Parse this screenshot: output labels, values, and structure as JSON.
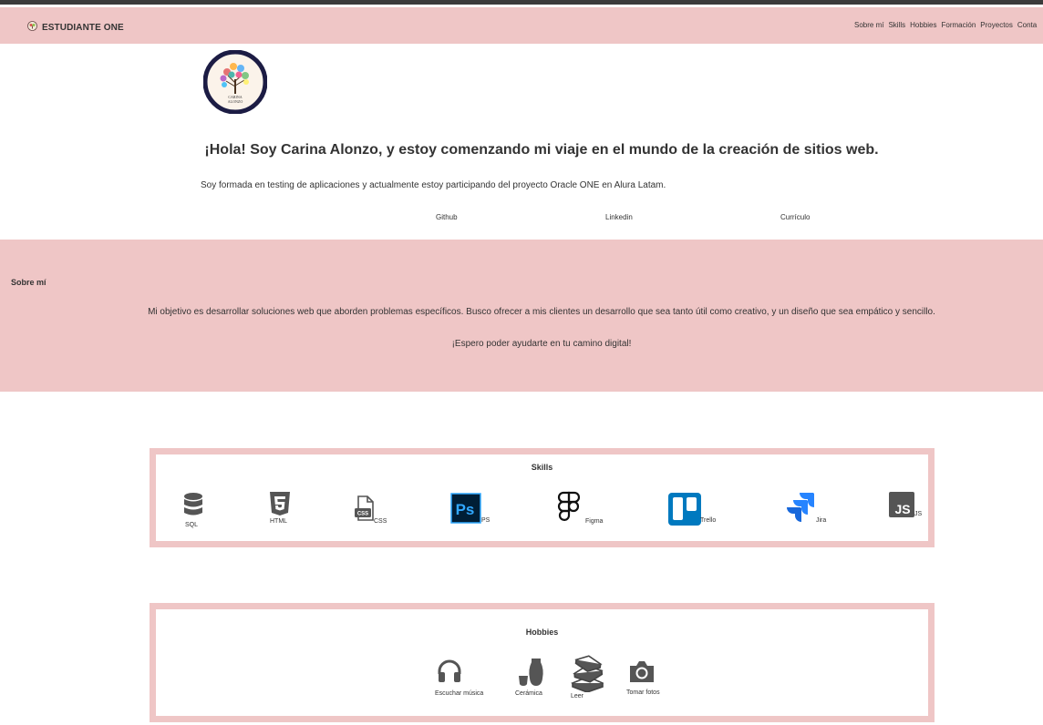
{
  "brand": {
    "name": "ESTUDIANTE ONE"
  },
  "nav": [
    "Sobre mí",
    "Skills",
    "Hobbies",
    "Formación",
    "Proyectos",
    "Conta"
  ],
  "logo": {
    "line1": "CARINA",
    "line2": "ALONZO"
  },
  "hero": {
    "title": "¡Hola! Soy Carina Alonzo, y estoy comenzando mi viaje en el mundo de la creación de sitios web.",
    "description": "Soy formada en testing de aplicaciones y actualmente estoy participando del proyecto Oracle ONE en Alura Latam.",
    "links": [
      "Github",
      "Linkedin",
      "Currículo"
    ]
  },
  "about": {
    "heading": "Sobre mí",
    "paragraph1": "Mi objetivo es desarrollar soluciones web que aborden problemas específicos. Busco ofrecer a mis clientes un desarrollo que sea tanto útil como creativo, y un diseño que sea empático y sencillo.",
    "paragraph2": "¡Espero poder ayudarte en tu camino digital!"
  },
  "skills": {
    "title": "Skills",
    "items": [
      {
        "label": "SQL",
        "icon": "database-icon"
      },
      {
        "label": "HTML",
        "icon": "html5-icon"
      },
      {
        "label": "CSS",
        "icon": "css-file-icon"
      },
      {
        "label": "PS",
        "icon": "photoshop-icon",
        "color": "#31a8ff"
      },
      {
        "label": "Figma",
        "icon": "figma-icon"
      },
      {
        "label": "Trello",
        "icon": "trello-icon",
        "color": "#0079bf"
      },
      {
        "label": "Jira",
        "icon": "jira-icon",
        "color": "#2684ff"
      },
      {
        "label": "JS",
        "icon": "javascript-icon"
      }
    ]
  },
  "hobbies": {
    "title": "Hobbies",
    "items": [
      {
        "label": "Escuchar música",
        "icon": "headphones-icon"
      },
      {
        "label": "Cerámica",
        "icon": "pottery-icon"
      },
      {
        "label": "Leer",
        "icon": "books-icon"
      },
      {
        "label": "Tomar fotos",
        "icon": "camera-icon"
      }
    ]
  }
}
